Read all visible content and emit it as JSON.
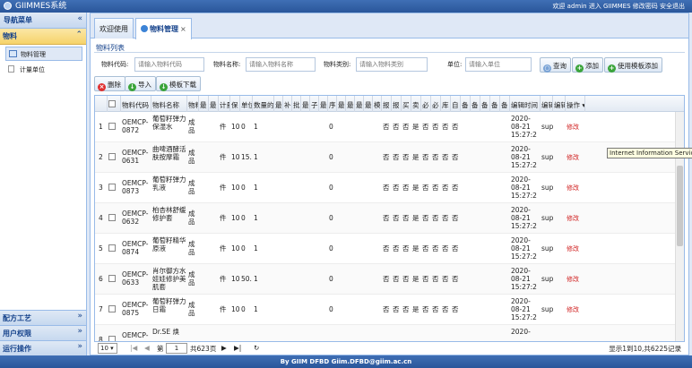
{
  "header": {
    "title": "GIIMMES系统",
    "user_text": "欢迎 admin 进入 GIIMMES 修改密码 安全退出"
  },
  "sidebar": {
    "title": "导航菜单",
    "collapse_glyph": "«",
    "active_group": {
      "label": "物料",
      "toggle": "⌃"
    },
    "items": [
      {
        "label": "物料管理",
        "icon": "folder-icon"
      },
      {
        "label": "计量单位",
        "icon": "document-icon"
      }
    ],
    "groups": [
      {
        "label": "配方工艺",
        "toggle": "»"
      },
      {
        "label": "用户权限",
        "toggle": "»"
      },
      {
        "label": "运行操作",
        "toggle": "»"
      }
    ]
  },
  "tabs": [
    {
      "label": "欢迎使用"
    },
    {
      "label": "物料管理",
      "close": "×"
    }
  ],
  "panel": {
    "title": "物料列表"
  },
  "search": {
    "code_label": "物料代码:",
    "code_placeholder": "请输入物料代码",
    "name_label": "物料名称:",
    "name_placeholder": "请输入物料名称",
    "type_label": "物料类别:",
    "type_placeholder": "请输入物料类别",
    "unit_label": "单位:",
    "unit_placeholder": "请输入单位",
    "query_label": "查询",
    "add_label": "添加",
    "template_add_label": "使用模板添加"
  },
  "toolbar": {
    "delete_label": "删除",
    "import_label": "导入",
    "template_download_label": "模板下载"
  },
  "grid": {
    "headers": [
      "",
      "",
      "物料代码",
      "物料名称",
      "物料",
      "最",
      "最",
      "计量",
      "保",
      "单位",
      "数量的",
      "最",
      "补",
      "批",
      "最",
      "子",
      "最",
      "序",
      "最",
      "最",
      "最",
      "最",
      "模",
      "报",
      "报",
      "买",
      "卖",
      "必",
      "必",
      "库",
      "自",
      "备",
      "备",
      "备",
      "备",
      "备",
      "编辑时间",
      "编辑",
      "编辑",
      "操作 ▾"
    ],
    "rows": [
      {
        "num": "1",
        "code": "OEMCP-0872",
        "name": "葡萄籽弹力保湿水",
        "type": "成品",
        "unit": "件",
        "shelf": "109",
        "uq": "0",
        "qty": "1",
        "seq": "0",
        "flags": [
          "否",
          "否",
          "否",
          "是",
          "否",
          "否",
          "否",
          "否"
        ],
        "date": "2020-",
        "time_a": "08-21",
        "time_b": "15:27:2",
        "editor": "sup",
        "op": "修改"
      },
      {
        "num": "2",
        "code": "OEMCP-0631",
        "name": "曲啤酒酵活肤按摩霜",
        "type": "成品",
        "unit": "件",
        "shelf": "109",
        "uq": "15.",
        "qty": "1",
        "seq": "0",
        "flags": [
          "否",
          "否",
          "否",
          "是",
          "否",
          "否",
          "否",
          "否"
        ],
        "date": "2020-",
        "time_a": "08-21",
        "time_b": "15:27:2",
        "editor": "sup",
        "op": "修改"
      },
      {
        "num": "3",
        "code": "OEMCP-0873",
        "name": "葡萄籽弹力乳液",
        "type": "成品",
        "unit": "件",
        "shelf": "109",
        "uq": "0",
        "qty": "1",
        "seq": "0",
        "flags": [
          "否",
          "否",
          "否",
          "是",
          "否",
          "否",
          "否",
          "否"
        ],
        "date": "2020-",
        "time_a": "08-21",
        "time_b": "15:27:2",
        "editor": "sup",
        "op": "修改"
      },
      {
        "num": "4",
        "code": "OEMCP-0632",
        "name": "柏杏林舒缓修护套",
        "type": "成品",
        "unit": "件",
        "shelf": "109",
        "uq": "0",
        "qty": "1",
        "seq": "0",
        "flags": [
          "否",
          "否",
          "否",
          "是",
          "否",
          "否",
          "否",
          "否"
        ],
        "date": "2020-",
        "time_a": "08-21",
        "time_b": "15:27:2",
        "editor": "sup",
        "op": "修改"
      },
      {
        "num": "5",
        "code": "OEMCP-0874",
        "name": "葡萄籽精华原液",
        "type": "成品",
        "unit": "件",
        "shelf": "109",
        "uq": "0",
        "qty": "1",
        "seq": "0",
        "flags": [
          "否",
          "否",
          "否",
          "是",
          "否",
          "否",
          "否",
          "否"
        ],
        "date": "2020-",
        "time_a": "08-21",
        "time_b": "15:27:2",
        "editor": "sup",
        "op": "修改"
      },
      {
        "num": "6",
        "code": "OEMCP-0633",
        "name": "肖尔御方水娃娃修护美肌套",
        "type": "成品",
        "unit": "件",
        "shelf": "109",
        "uq": "50.",
        "qty": "1",
        "seq": "0",
        "flags": [
          "否",
          "否",
          "否",
          "是",
          "否",
          "否",
          "否",
          "否"
        ],
        "date": "2020-",
        "time_a": "08-21",
        "time_b": "15:27:2",
        "editor": "sup",
        "op": "修改"
      },
      {
        "num": "7",
        "code": "OEMCP-0875",
        "name": "葡萄籽弹力日霜",
        "type": "成品",
        "unit": "件",
        "shelf": "109",
        "uq": "0",
        "qty": "1",
        "seq": "0",
        "flags": [
          "否",
          "否",
          "否",
          "是",
          "否",
          "否",
          "否",
          "否"
        ],
        "date": "2020-",
        "time_a": "08-21",
        "time_b": "15:27:2",
        "editor": "sup",
        "op": "修改"
      },
      {
        "num": "8",
        "code": "OEMCP-",
        "name": "Dr.SE 焕",
        "type": "",
        "unit": "",
        "shelf": "",
        "uq": "",
        "qty": "",
        "seq": "",
        "flags": [
          "",
          "",
          "",
          "",
          "",
          "",
          "",
          ""
        ],
        "date": "2020-",
        "time_a": "",
        "time_b": "",
        "editor": "",
        "op": ""
      }
    ]
  },
  "pager": {
    "page_size": "10",
    "page_prefix": "第",
    "page_value": "1",
    "page_suffix": "共623页",
    "summary": "显示1到10,共6225记录"
  },
  "tooltip": {
    "text": "Internet Information Services"
  },
  "footer": {
    "text": "By GIIM DFBD    Giim.DFBD@giim.ac.cn"
  }
}
